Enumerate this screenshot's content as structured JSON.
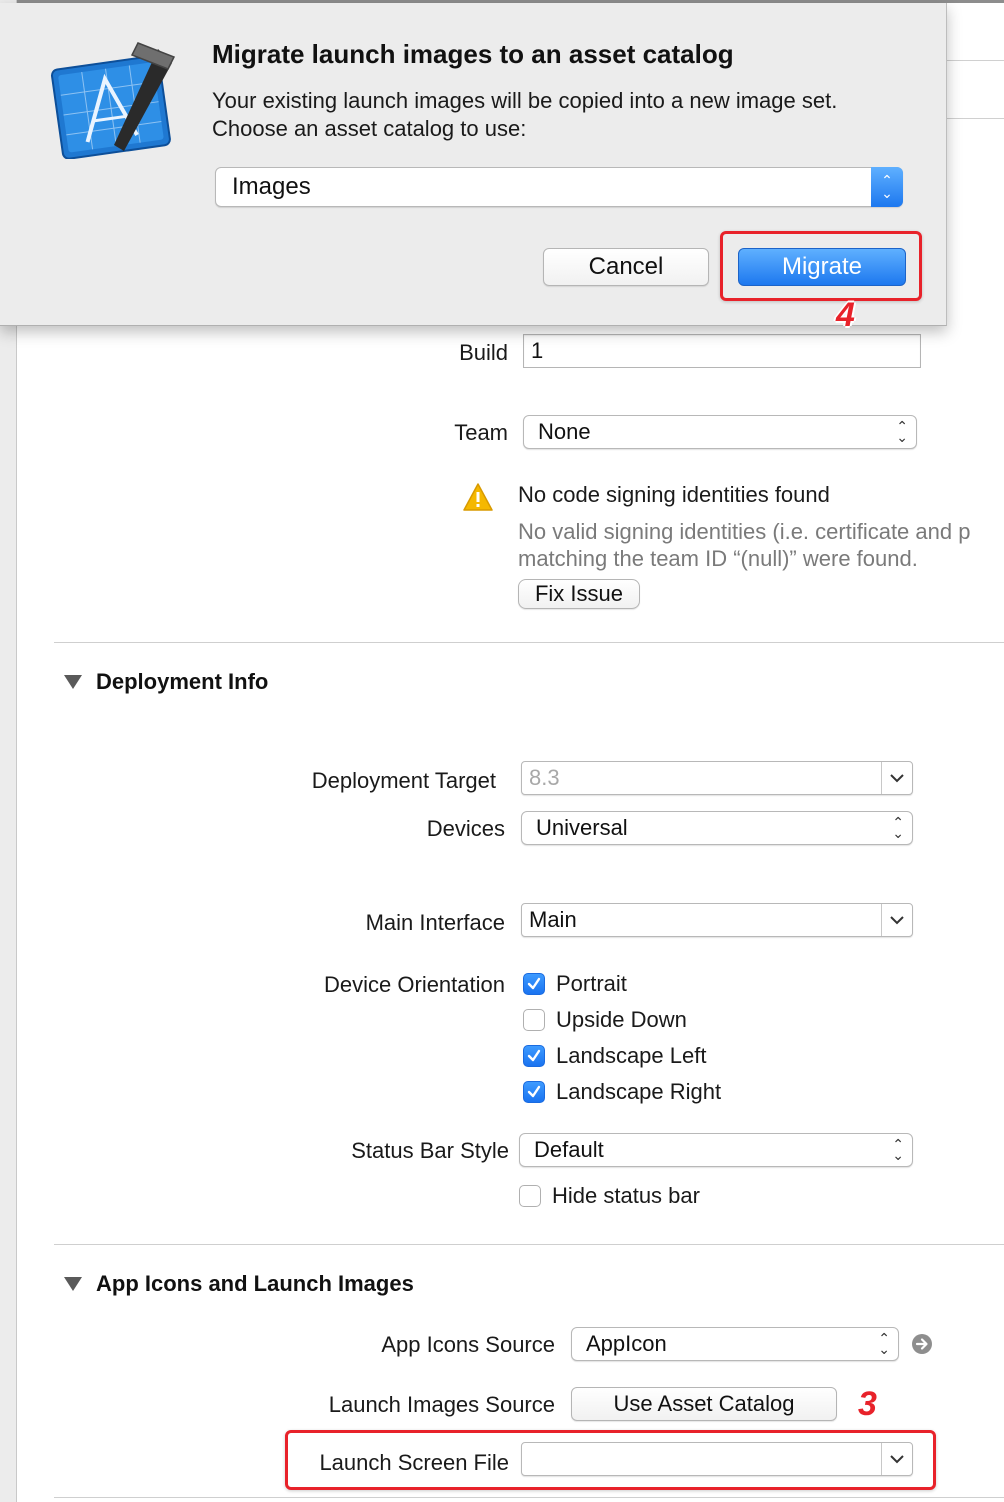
{
  "dialog": {
    "title": "Migrate launch images to an asset catalog",
    "message": "Your existing launch images will be copied into a new image set. Choose an asset catalog to use:",
    "catalog_value": "Images",
    "cancel_label": "Cancel",
    "migrate_label": "Migrate",
    "app_icon": "xcode-icon",
    "callout_number": "4"
  },
  "identity": {
    "build_label": "Build",
    "build_value": "1",
    "team_label": "Team",
    "team_value": "None",
    "warning_title": "No code signing identities found",
    "warning_detail": "No valid signing identities (i.e. certificate and p matching the team ID “(null)” were found.",
    "fix_issue_label": "Fix Issue"
  },
  "deployment": {
    "section_title": "Deployment Info",
    "target_label": "Deployment Target",
    "target_value": "8.3",
    "devices_label": "Devices",
    "devices_value": "Universal",
    "main_interface_label": "Main Interface",
    "main_interface_value": "Main",
    "orientation_label": "Device Orientation",
    "orientations": [
      {
        "label": "Portrait",
        "checked": true
      },
      {
        "label": "Upside Down",
        "checked": false
      },
      {
        "label": "Landscape Left",
        "checked": true
      },
      {
        "label": "Landscape Right",
        "checked": true
      }
    ],
    "status_bar_label": "Status Bar Style",
    "status_bar_value": "Default",
    "hide_status_bar_label": "Hide status bar",
    "hide_status_bar_checked": false
  },
  "app_icons": {
    "section_title": "App Icons and Launch Images",
    "icons_source_label": "App Icons Source",
    "icons_source_value": "AppIcon",
    "launch_images_label": "Launch Images Source",
    "use_asset_catalog_label": "Use Asset Catalog",
    "launch_screen_label": "Launch Screen File",
    "launch_screen_value": "",
    "callout_number": "3"
  },
  "colors": {
    "accent_blue": "#1d78ef",
    "callout_red": "#e8222a",
    "warning_yellow": "#f5b800"
  }
}
